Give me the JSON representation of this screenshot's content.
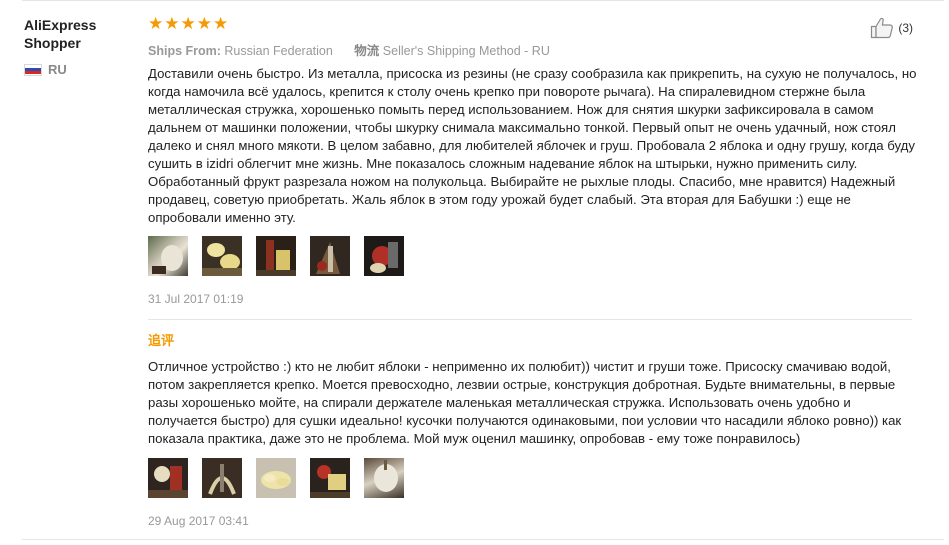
{
  "user": {
    "name": "AliExpress Shopper",
    "country_code": "RU",
    "flag_colors": [
      "#ffffff",
      "#2b4bb5",
      "#d52b1e"
    ]
  },
  "review": {
    "rating": 5,
    "star_glyph": "★",
    "star_color": "#f59a00",
    "helpful_count": "(3)",
    "ships_from_label": "Ships From:",
    "ships_from_value": "Russian Federation",
    "shipping_cn_label": "物流",
    "shipping_method": "Seller's Shipping Method - RU",
    "text": "Доставили очень быстро. Из металла, присоска из резины (не сразу сообразила как прикрепить, на сухую не получалось, но когда намочила всё удалось, крепится к столу очень крепко при повороте рычага). На спиралевидном стержне была металлическая стружка, хорошенько помыть перед использованием. Нож для снятия шкурки зафиксировала в самом дальнем от машинки положении, чтобы шкурку снимала максимально тонкой. Первый опыт не очень удачный, нож стоял далеко и снял много мякоти. В целом забавно, для любителей яблочек и груш. Пробовала 2 яблока и одну грушу, когда буду сушить в izidri облегчит мне жизнь. Мне показалось сложным надевание яблок на штырьки, нужно применить силу. Обработанный фрукт разрезала ножом на полукольца. Выбирайте не рыхлые плоды. Спасибо, мне нравится) Надежный продавец, советую приобретать. Жаль яблок в этом году урожай будет слабый. Эта вторая для Бабушки :) еще не опробовали именно эту.",
    "date": "31 Jul 2017 01:19"
  },
  "followup": {
    "label": "追评",
    "text": "Отличное устройство :) кто не любит яблоки - неприменно их полюбит)) чистит и груши тоже. Присоску смачиваю водой, потом закрепляется крепко. Моется превосходно, лезвии острые, конструкция добротная. Будьте внимательны, в первые разы хорошенько мойте, на спирали держателе маленькая металлическая стружка. Использовать очень удобно и получается быстро) для сушки идеально! кусочки получаются одинаковыми, пои условии что насадили яблоко ровно)) как показала практика, даже это не проблема. Мой муж оценил машинку, опробовав - ему тоже понравилось)",
    "date": "29 Aug 2017 03:41"
  }
}
